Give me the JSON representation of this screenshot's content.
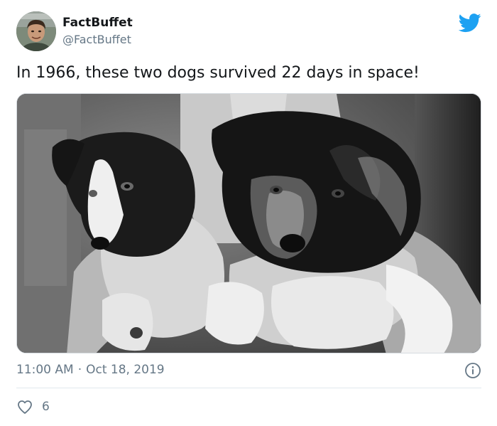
{
  "tweet": {
    "author": {
      "display_name": "FactBuffet",
      "handle": "@FactBuffet",
      "avatar_icon": "profile-photo"
    },
    "brand_icon": "twitter-bird-icon",
    "text": "In 1966, these two dogs survived 22 days in space!",
    "media": {
      "type": "photo",
      "style": "black-and-white",
      "subject": "two dogs held up by gloved hands"
    },
    "time": "11:00 AM",
    "date_separator": "·",
    "date": "Oct 18, 2019",
    "info_icon": "info-circle-icon",
    "likes": {
      "icon": "heart-outline-icon",
      "count": "6"
    }
  },
  "colors": {
    "brand": "#1da1f2",
    "text": "#14171a",
    "secondary_text": "#657786",
    "divider": "#e1e8ed"
  }
}
